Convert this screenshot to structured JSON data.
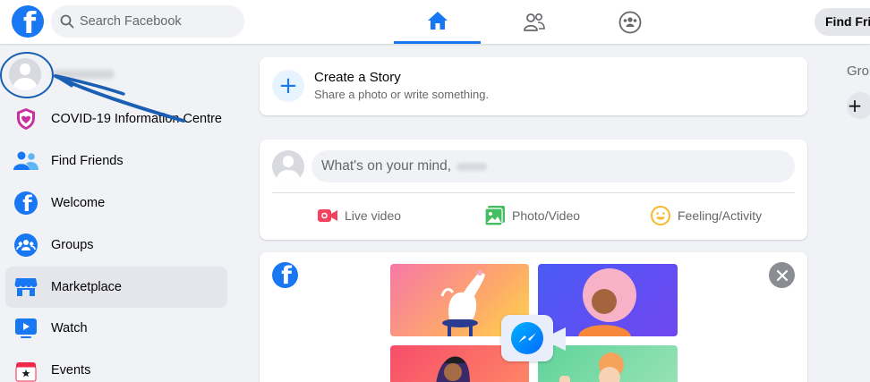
{
  "topbar": {
    "search_placeholder": "Search Facebook",
    "logo_letter": "f",
    "find_friends_label": "Find Frie",
    "tabs": [
      {
        "name": "home",
        "icon": "home-icon",
        "active": true
      },
      {
        "name": "friends",
        "icon": "friends-icon",
        "active": false
      },
      {
        "name": "groups",
        "icon": "groups-icon",
        "active": false
      }
    ]
  },
  "sidebar": {
    "items": [
      {
        "label": "COVID-19 Information Centre",
        "icon": "covid-shield-icon"
      },
      {
        "label": "Find Friends",
        "icon": "find-friends-icon"
      },
      {
        "label": "Welcome",
        "icon": "facebook-icon"
      },
      {
        "label": "Groups",
        "icon": "groups-icon"
      },
      {
        "label": "Marketplace",
        "icon": "marketplace-icon",
        "selected": true
      },
      {
        "label": "Watch",
        "icon": "watch-icon"
      },
      {
        "label": "Events",
        "icon": "events-icon"
      }
    ]
  },
  "story": {
    "plus": "+",
    "title": "Create a Story",
    "subtitle": "Share a photo or write something."
  },
  "composer": {
    "prompt": "What's on your mind,",
    "actions": [
      {
        "label": "Live video",
        "icon": "live-video-icon",
        "color": "#f3425f"
      },
      {
        "label": "Photo/Video",
        "icon": "photo-video-icon",
        "color": "#45bd62"
      },
      {
        "label": "Feeling/Activity",
        "icon": "feeling-icon",
        "color": "#f7b928"
      }
    ]
  },
  "promo": {
    "logo_letter": "f"
  },
  "right": {
    "heading": "Gro",
    "plus": "+"
  },
  "colors": {
    "brand": "#1877f2",
    "background": "#f0f2f5",
    "annotation": "#1a5fb4"
  }
}
